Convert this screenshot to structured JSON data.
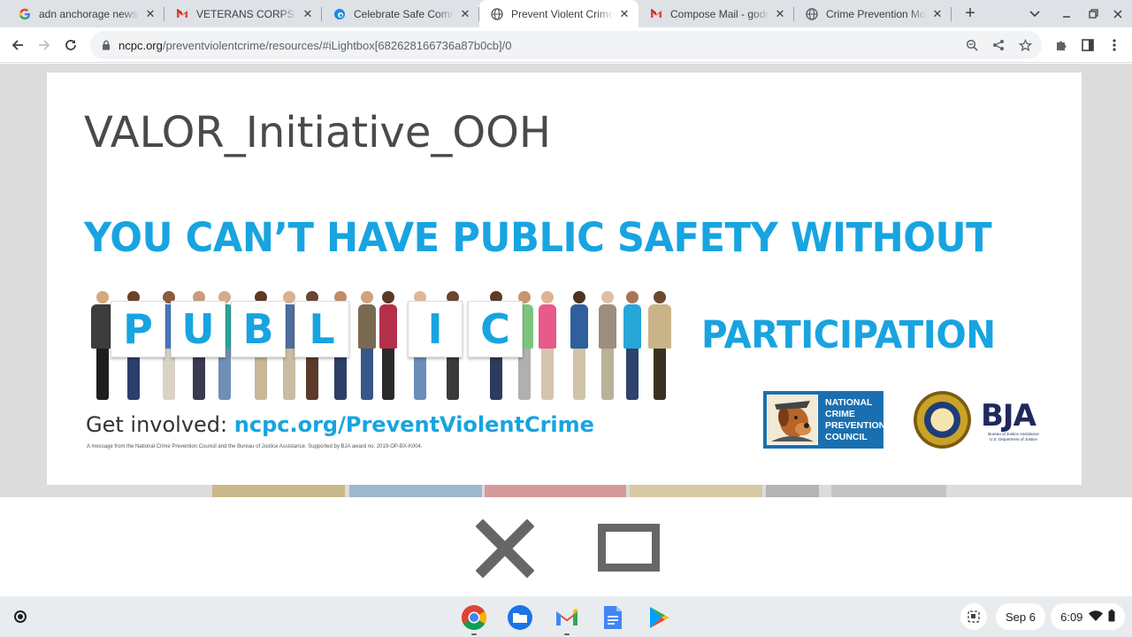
{
  "browser": {
    "tabs": [
      {
        "title": "adn anchorage news - G",
        "favicon": "google-icon",
        "active": false
      },
      {
        "title": "VETERANS CORPS OF F",
        "favicon": "gmail-icon",
        "active": false
      },
      {
        "title": "Celebrate Safe Commu",
        "favicon": "edge-swirl-icon",
        "active": false
      },
      {
        "title": "Prevent Violent Crime -",
        "favicon": "globe-icon",
        "active": true
      },
      {
        "title": "Compose Mail - godde",
        "favicon": "gmail-icon",
        "active": false
      },
      {
        "title": "Crime Prevention Mont",
        "favicon": "globe-icon",
        "active": false
      }
    ],
    "new_tab_label": "+",
    "url_host": "ncpc.org",
    "url_path": "/preventviolentcrime/resources/#iLightbox[682628166736a87b0cb]/0"
  },
  "lightbox": {
    "title": "VALOR_Initiative_OOH",
    "headline": "YOU CAN’T HAVE PUBLIC SAFETY WITHOUT",
    "card_letters": [
      "P",
      "U",
      "B",
      "L",
      "I",
      "C"
    ],
    "participation": "PARTICIPATION",
    "get_involved_prefix": "Get involved:",
    "get_involved_link": "ncpc.org/PreventViolentCrime",
    "disclaimer": "A message from the National Crime Prevention Council and the Bureau of Justice Assistance. Supported by BJA award no. 2019-OP-BX-K004.",
    "ncpc_logo_lines": [
      "NATIONAL",
      "CRIME",
      "PREVENTION",
      "COUNCIL"
    ],
    "bja_logo_text": "BJA",
    "bja_logo_subtext": "Bureau of Justice Assistance",
    "bja_logo_subtext2": "U.S. Department of Justice"
  },
  "shelf": {
    "apps": [
      "chrome-icon",
      "files-icon",
      "gmail-icon",
      "docs-icon",
      "play-store-icon"
    ],
    "date": "Sep 6",
    "time": "6:09"
  },
  "colors": {
    "accent_blue": "#18a4e0",
    "ncpc_blue": "#1a6fb0",
    "bja_navy": "#1f2a5c"
  }
}
